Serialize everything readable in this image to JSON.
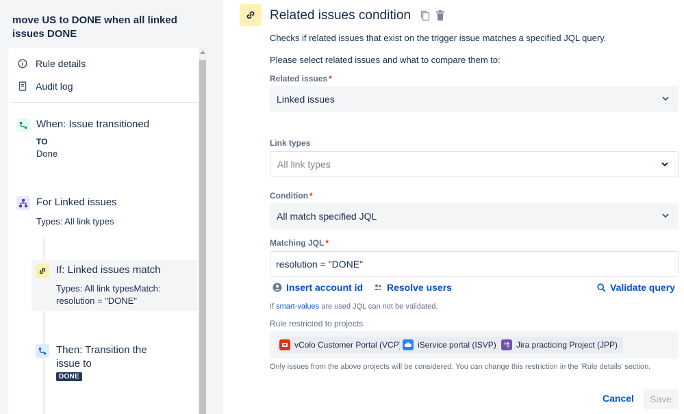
{
  "rule": {
    "title": "move US to DONE when all linked issues DONE"
  },
  "sidebar": {
    "nav": [
      {
        "label": "Rule details",
        "icon": "info-icon"
      },
      {
        "label": "Audit log",
        "icon": "audit-log-icon"
      }
    ],
    "trigger": {
      "title": "When: Issue transitioned",
      "to_label": "TO",
      "to_value": "Done",
      "icon": "trigger-icon"
    },
    "branch": {
      "title": "For Linked issues",
      "subtitle": "Types: All link types",
      "icon": "branch-icon"
    },
    "condition": {
      "title": "If: Linked issues match",
      "subtitle_line1": "Types: All link typesMatch:",
      "subtitle_line2": "resolution = \"DONE\"",
      "icon": "link-icon"
    },
    "action": {
      "title_line1": "Then: Transition the",
      "title_line2": "issue to",
      "status": "DONE",
      "icon": "transition-icon"
    }
  },
  "panel": {
    "title": "Related issues condition",
    "description": "Checks if related issues that exist on the trigger issue matches a specified JQL query.",
    "instruction": "Please select related issues and what to compare them to:",
    "related_issues": {
      "label": "Related issues",
      "value": "Linked issues"
    },
    "link_types": {
      "label": "Link types",
      "placeholder": "All link types"
    },
    "condition": {
      "label": "Condition",
      "value": "All match specified JQL"
    },
    "matching_jql": {
      "label": "Matching JQL",
      "value": "resolution = \"DONE\""
    },
    "actions": {
      "insert_account": "Insert account id",
      "resolve_users": "Resolve users",
      "validate": "Validate query"
    },
    "smart_note_prefix": "If ",
    "smart_note_link": "smart-values",
    "smart_note_suffix": " are used JQL can not be validated.",
    "projects_label": "Rule restricted to projects",
    "projects": [
      {
        "name": "vColo Customer Portal (VCP)",
        "color": "#de350b"
      },
      {
        "name": "iService portal (ISVP)",
        "color": "#2684ff"
      },
      {
        "name": "Jira practicing Project (JPP)",
        "color": "#6554c0"
      }
    ],
    "projects_note": "Only issues from the above projects will be considered. You can change this restriction in the 'Rule details' section.",
    "cancel_label": "Cancel",
    "save_label": "Save"
  }
}
